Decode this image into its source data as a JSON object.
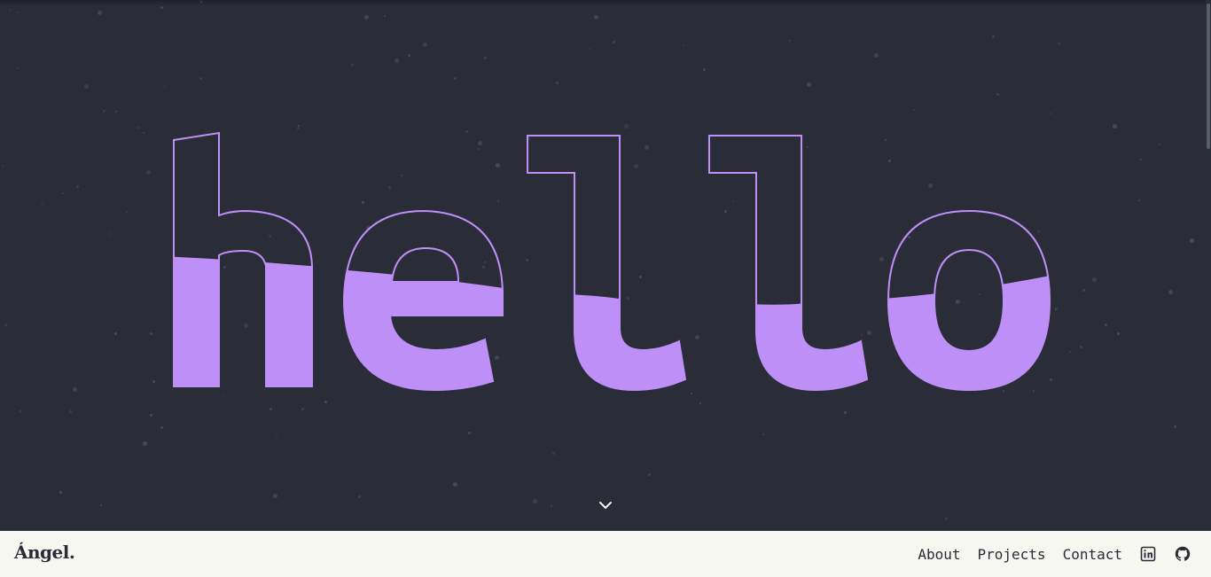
{
  "hero": {
    "word": "hello",
    "letters": [
      "h",
      "e",
      "l",
      "l",
      "o"
    ],
    "scroll_icon": "chevron-down-icon",
    "colors": {
      "background": "#2a2c38",
      "accent": "#bf8ff8",
      "star": "#4a4d5c"
    }
  },
  "navbar": {
    "logo": "Ángel.",
    "links": [
      {
        "label": "About"
      },
      {
        "label": "Projects"
      },
      {
        "label": "Contact"
      }
    ],
    "icons": [
      "linkedin-icon",
      "github-icon"
    ],
    "background": "#f6f7f1",
    "text_color": "#2a2c38"
  }
}
